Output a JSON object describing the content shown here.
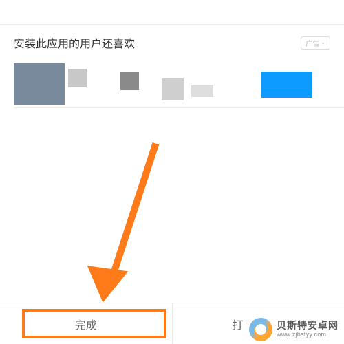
{
  "section": {
    "title": "安装此应用的用户还喜欢",
    "ad_label": "广告"
  },
  "bottom": {
    "done_label": "完成",
    "open_label": "打"
  },
  "watermark": {
    "line1": "贝斯特安卓网",
    "line2": "www.zjbstyy.com"
  }
}
